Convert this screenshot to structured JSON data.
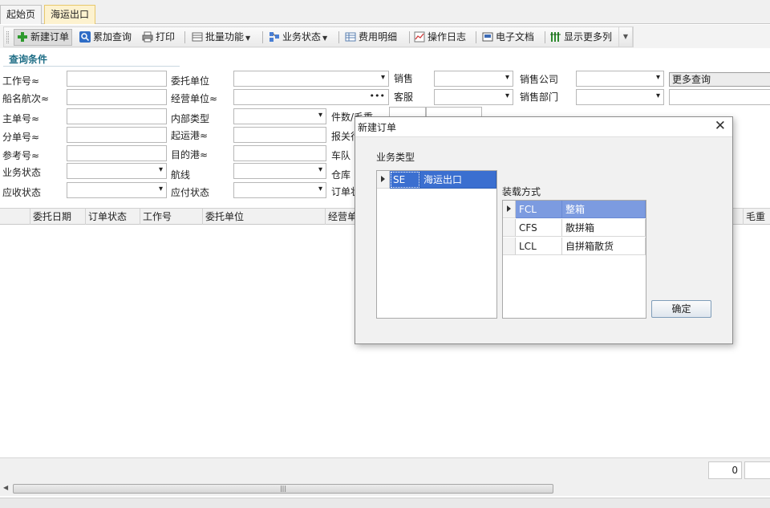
{
  "tabs": [
    {
      "label": "起始页",
      "active": false
    },
    {
      "label": "海运出口",
      "active": true
    }
  ],
  "toolbar": {
    "items": [
      {
        "label": "新建订单",
        "icon": "add-icon"
      },
      {
        "label": "累加查询",
        "icon": "search-icon"
      },
      {
        "label": "打印",
        "icon": "printer-icon"
      },
      {
        "label": "批量功能",
        "icon": "batch-icon"
      },
      {
        "label": "业务状态",
        "icon": "status-icon"
      },
      {
        "label": "费用明细",
        "icon": "table-icon"
      },
      {
        "label": "操作日志",
        "icon": "log-chart-icon"
      },
      {
        "label": "电子文档",
        "icon": "document-icon"
      },
      {
        "label": "显示更多列",
        "icon": "columns-icon"
      }
    ]
  },
  "query": {
    "title": "查询条件",
    "labels": {
      "job_no": "工作号≈",
      "vessel_voyage": "船名航次≈",
      "master_bl": "主单号≈",
      "house_bl": "分单号≈",
      "reference_no": "参考号≈",
      "business_status": "业务状态",
      "receivable_status": "应收状态",
      "client": "委托单位",
      "operating_unit": "经营单位≈",
      "internal_type": "内部类型",
      "port_loading": "起运港≈",
      "port_destination": "目的港≈",
      "route": "航线",
      "payable_status": "应付状态",
      "sales": "销售",
      "customer_service": "客服",
      "pieces_gross": "件数/毛重",
      "customs_broker": "报关行",
      "fleet": "车队",
      "warehouse": "仓库",
      "order_label": "订单状",
      "sales_company": "销售公司",
      "sales_dept": "销售部门"
    },
    "more_query": "更多查询"
  },
  "grid": {
    "columns": [
      "委托日期",
      "订单状态",
      "工作号",
      "委托单位",
      "经营单",
      "毛重"
    ],
    "footer_count": "0"
  },
  "dialog": {
    "title": "新建订单",
    "business_type_label": "业务类型",
    "business_types": [
      {
        "code": "SE",
        "name": "海运出口"
      }
    ],
    "loading_method_label": "装载方式",
    "loading_methods": [
      {
        "code": "FCL",
        "name": "整箱"
      },
      {
        "code": "CFS",
        "name": "散拼箱"
      },
      {
        "code": "LCL",
        "name": "自拼箱散货"
      }
    ],
    "ok_label": "确定"
  }
}
